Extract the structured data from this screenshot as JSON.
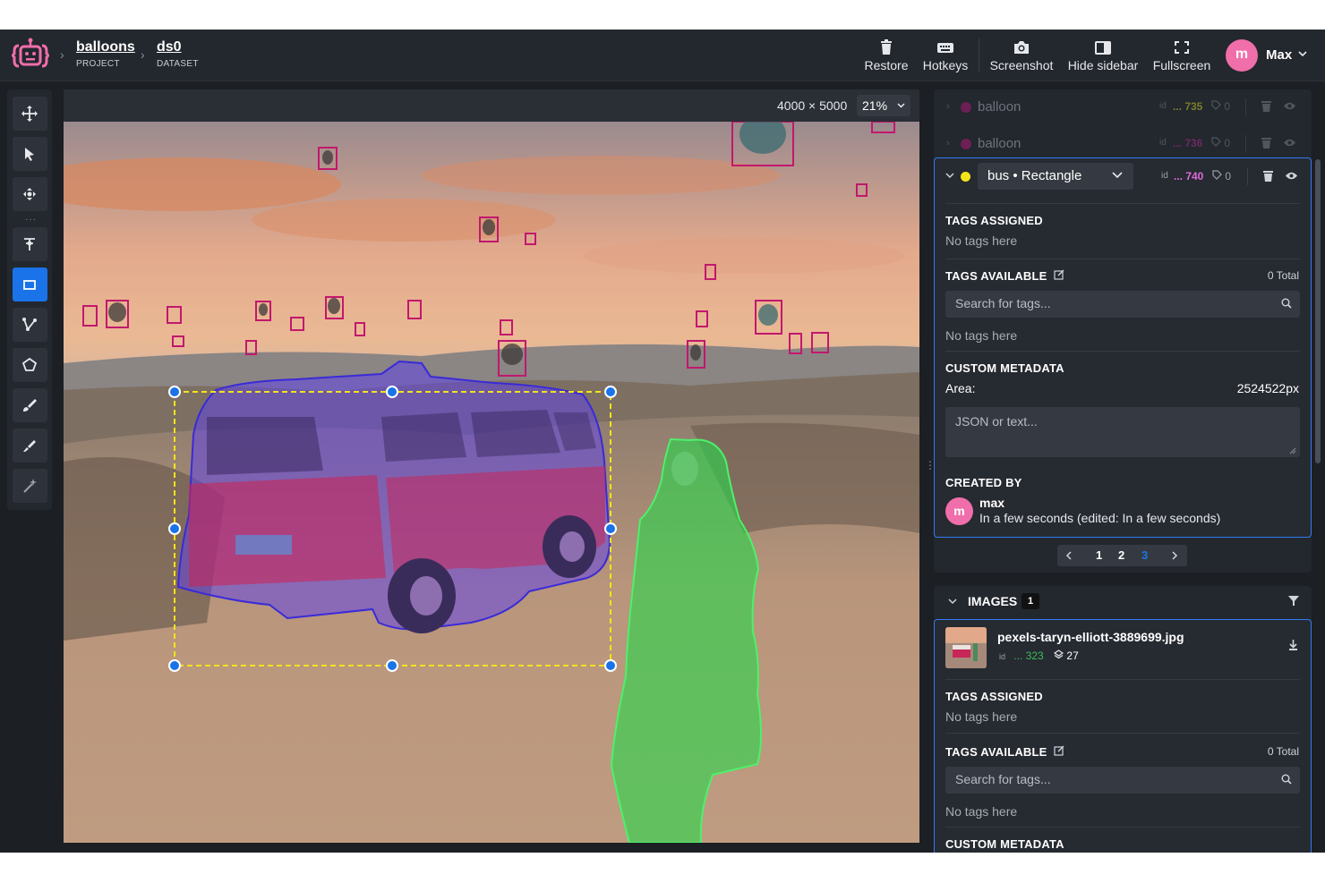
{
  "header": {
    "breadcrumbs": [
      {
        "name": "balloons",
        "kind": "PROJECT"
      },
      {
        "name": "ds0",
        "kind": "DATASET"
      }
    ],
    "actions": [
      {
        "label": "Restore",
        "icon": "trash-icon"
      },
      {
        "label": "Hotkeys",
        "icon": "keyboard-icon"
      },
      {
        "label": "Screenshot",
        "icon": "camera-icon"
      },
      {
        "label": "Hide sidebar",
        "icon": "sidebar-icon"
      },
      {
        "label": "Fullscreen",
        "icon": "fullscreen-icon"
      }
    ],
    "user": {
      "initial": "m",
      "name": "Max"
    }
  },
  "canvas": {
    "dimensions": "4000 × 5000",
    "zoom": "21%"
  },
  "objects": {
    "rows": [
      {
        "label": "balloon",
        "id_label": "id",
        "id_value": "... 735",
        "id_color": "#8a8f2a",
        "tags": "0",
        "dot_color": "#7a1f5c"
      },
      {
        "label": "balloon",
        "id_label": "id",
        "id_value": "... 736",
        "id_color": "#7a2a6a",
        "tags": "0",
        "dot_color": "#7a1f5c"
      }
    ],
    "selected": {
      "class_label": "bus • Rectangle",
      "id_label": "id",
      "id_value": "... 740",
      "tags": "0",
      "tags_assigned_title": "TAGS ASSIGNED",
      "tags_assigned_empty": "No tags here",
      "tags_available_title": "TAGS AVAILABLE",
      "tags_available_total": "0 Total",
      "search_placeholder": "Search for tags...",
      "tags_available_empty": "No tags here",
      "custom_metadata_title": "CUSTOM METADATA",
      "area_label": "Area:",
      "area_value": "2524522px",
      "json_placeholder": "JSON or text...",
      "created_by_title": "CREATED BY",
      "creator_initial": "m",
      "creator_name": "max",
      "created_time": "In a few seconds (edited: In a few seconds)"
    },
    "pagination": [
      "1",
      "2",
      "3"
    ]
  },
  "images": {
    "title": "IMAGES",
    "count": "1",
    "item": {
      "name": "pexels-taryn-elliott-3889699.jpg",
      "id_label": "id",
      "id_value": "... 323",
      "objects_count": "27",
      "tags_assigned_title": "TAGS ASSIGNED",
      "tags_assigned_empty": "No tags here",
      "tags_available_title": "TAGS AVAILABLE",
      "tags_available_total": "0 Total",
      "search_placeholder": "Search for tags...",
      "tags_available_empty": "No tags here",
      "custom_metadata_title": "CUSTOM METADATA"
    }
  },
  "colors": {
    "accent": "#1a73e8",
    "bus_rect": "#f5e31b",
    "bus_mask": "#5b3df0",
    "person_mask": "#27d84a",
    "balloon_box": "#c2186d"
  }
}
